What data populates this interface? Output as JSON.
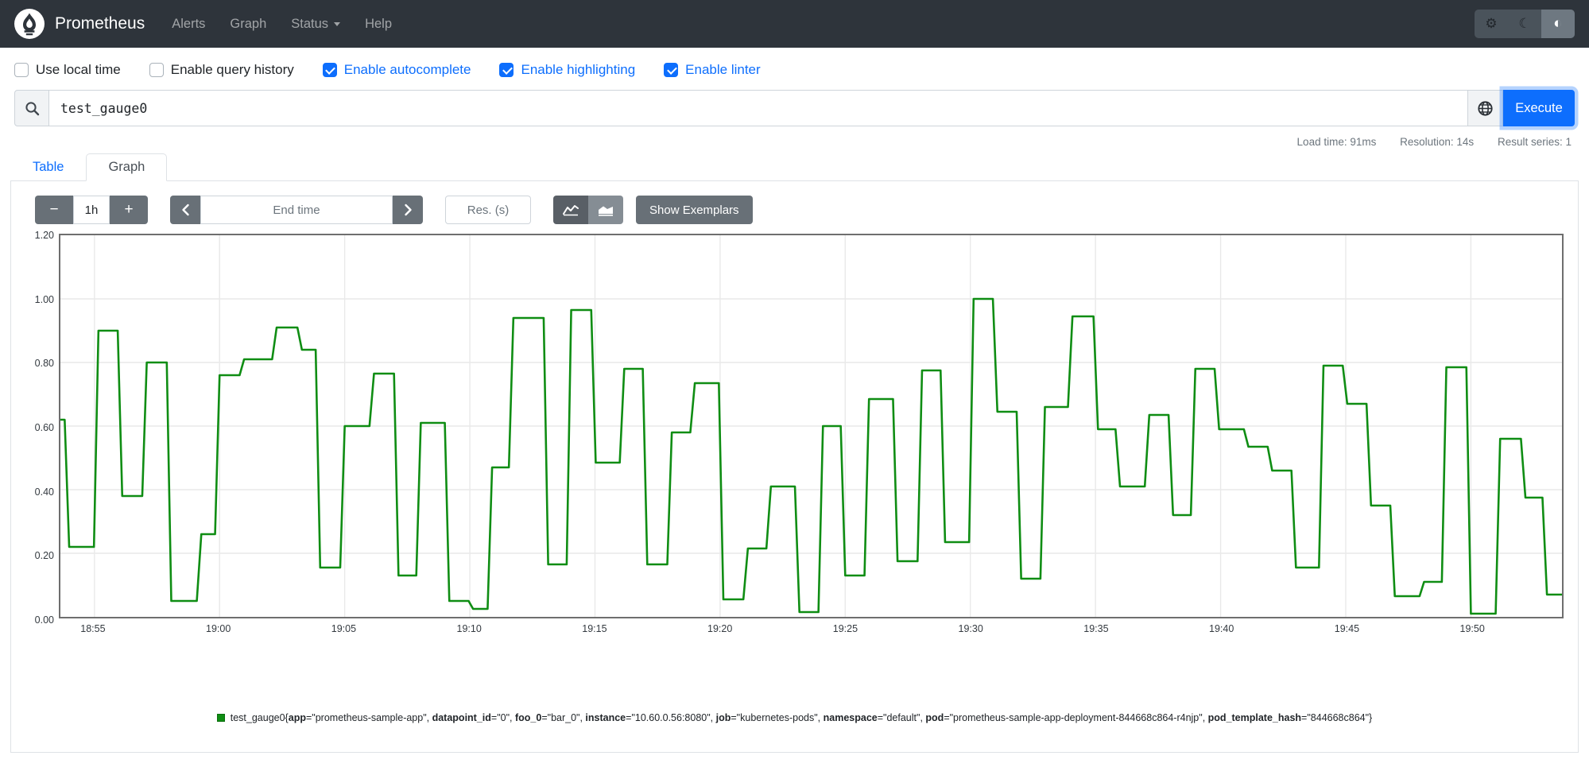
{
  "colors": {
    "navbar_bg": "#2e343b",
    "accent_blue": "#0d6efd",
    "graph_line_green": "#0f8d13",
    "grid_gray": "#e9e9e9"
  },
  "navbar": {
    "brand": "Prometheus",
    "items": [
      {
        "label": "Alerts"
      },
      {
        "label": "Graph"
      },
      {
        "label": "Status"
      },
      {
        "label": "Help"
      }
    ]
  },
  "theme_buttons": [
    {
      "icon": "gear-icon",
      "glyph": "⚙",
      "active": false
    },
    {
      "icon": "moon-icon",
      "glyph": "☾",
      "active": false
    },
    {
      "icon": "half-circle-icon",
      "glyph": "◐",
      "active": true
    }
  ],
  "options": {
    "items": [
      {
        "label": "Use local time",
        "checked": false
      },
      {
        "label": "Enable query history",
        "checked": false
      },
      {
        "label": "Enable autocomplete",
        "checked": true
      },
      {
        "label": "Enable highlighting",
        "checked": true
      },
      {
        "label": "Enable linter",
        "checked": true
      }
    ]
  },
  "query": {
    "value": "test_gauge0",
    "execute_label": "Execute"
  },
  "stats": {
    "load_time": "Load time: 91ms",
    "resolution": "Resolution: 14s",
    "result_series": "Result series: 1"
  },
  "tabs": [
    {
      "label": "Table",
      "active": false
    },
    {
      "label": "Graph",
      "active": true
    }
  ],
  "controls": {
    "range_minus": "−",
    "range_value": "1h",
    "range_plus": "+",
    "end_time_placeholder": "End time",
    "res_placeholder": "Res. (s)",
    "show_exemplars": "Show Exemplars",
    "active_chart_type": "line"
  },
  "chart_data": {
    "type": "line",
    "title": "",
    "xlabel": "",
    "ylabel": "",
    "ylim": [
      0,
      1.2
    ],
    "y_tick_labels": [
      "0.00",
      "0.20",
      "0.40",
      "0.60",
      "0.80",
      "1.00",
      "1.20"
    ],
    "x_tick_labels": [
      "18:55",
      "19:00",
      "19:05",
      "19:10",
      "19:15",
      "19:20",
      "19:25",
      "19:30",
      "19:35",
      "19:40",
      "19:45",
      "19:50"
    ],
    "x_tick_start_min": 1.36,
    "x_tick_step_min": 5,
    "x_range_minutes": [
      0,
      60
    ],
    "grid": true,
    "legend_position": "bottom-center",
    "series": [
      {
        "name": "test_gauge0",
        "color": "#0f8d13",
        "step_segments": [
          [
            0,
            0.62
          ],
          [
            0.35,
            0.22
          ],
          [
            1.52,
            0.9
          ],
          [
            2.47,
            0.38
          ],
          [
            3.45,
            0.8
          ],
          [
            4.43,
            0.05
          ],
          [
            5.63,
            0.26
          ],
          [
            6.36,
            0.76
          ],
          [
            7.34,
            0.81
          ],
          [
            8.64,
            0.91
          ],
          [
            9.65,
            0.84
          ],
          [
            10.38,
            0.155
          ],
          [
            11.36,
            0.6
          ],
          [
            12.53,
            0.765
          ],
          [
            13.51,
            0.13
          ],
          [
            14.4,
            0.61
          ],
          [
            15.54,
            0.05
          ],
          [
            16.49,
            0.025
          ],
          [
            17.25,
            0.47
          ],
          [
            18.1,
            0.94
          ],
          [
            19.49,
            0.165
          ],
          [
            20.41,
            0.965
          ],
          [
            21.39,
            0.485
          ],
          [
            22.53,
            0.78
          ],
          [
            23.45,
            0.165
          ],
          [
            24.43,
            0.58
          ],
          [
            25.35,
            0.735
          ],
          [
            26.49,
            0.055
          ],
          [
            27.47,
            0.215
          ],
          [
            28.39,
            0.41
          ],
          [
            29.53,
            0.015
          ],
          [
            30.47,
            0.6
          ],
          [
            31.36,
            0.13
          ],
          [
            32.31,
            0.685
          ],
          [
            33.45,
            0.175
          ],
          [
            34.43,
            0.775
          ],
          [
            35.35,
            0.235
          ],
          [
            36.49,
            1.0
          ],
          [
            37.44,
            0.645
          ],
          [
            38.39,
            0.12
          ],
          [
            39.34,
            0.66
          ],
          [
            40.44,
            0.945
          ],
          [
            41.46,
            0.59
          ],
          [
            42.34,
            0.41
          ],
          [
            43.51,
            0.635
          ],
          [
            44.46,
            0.32
          ],
          [
            45.35,
            0.78
          ],
          [
            46.3,
            0.59
          ],
          [
            47.47,
            0.535
          ],
          [
            48.42,
            0.46
          ],
          [
            49.37,
            0.155
          ],
          [
            50.47,
            0.79
          ],
          [
            51.42,
            0.67
          ],
          [
            52.37,
            0.35
          ],
          [
            53.32,
            0.065
          ],
          [
            54.49,
            0.11
          ],
          [
            55.38,
            0.785
          ],
          [
            56.36,
            0.01
          ],
          [
            57.53,
            0.56
          ],
          [
            58.54,
            0.375
          ],
          [
            59.4,
            0.07
          ]
        ],
        "end_min": 60
      }
    ]
  },
  "legend": {
    "marker_color": "#0f8d13",
    "metric": "test_gauge0",
    "labels": [
      [
        "app",
        "prometheus-sample-app"
      ],
      [
        "datapoint_id",
        "0"
      ],
      [
        "foo_0",
        "bar_0"
      ],
      [
        "instance",
        "10.60.0.56:8080"
      ],
      [
        "job",
        "kubernetes-pods"
      ],
      [
        "namespace",
        "default"
      ],
      [
        "pod",
        "prometheus-sample-app-deployment-844668c864-r4njp"
      ],
      [
        "pod_template_hash",
        "844668c864"
      ]
    ]
  }
}
